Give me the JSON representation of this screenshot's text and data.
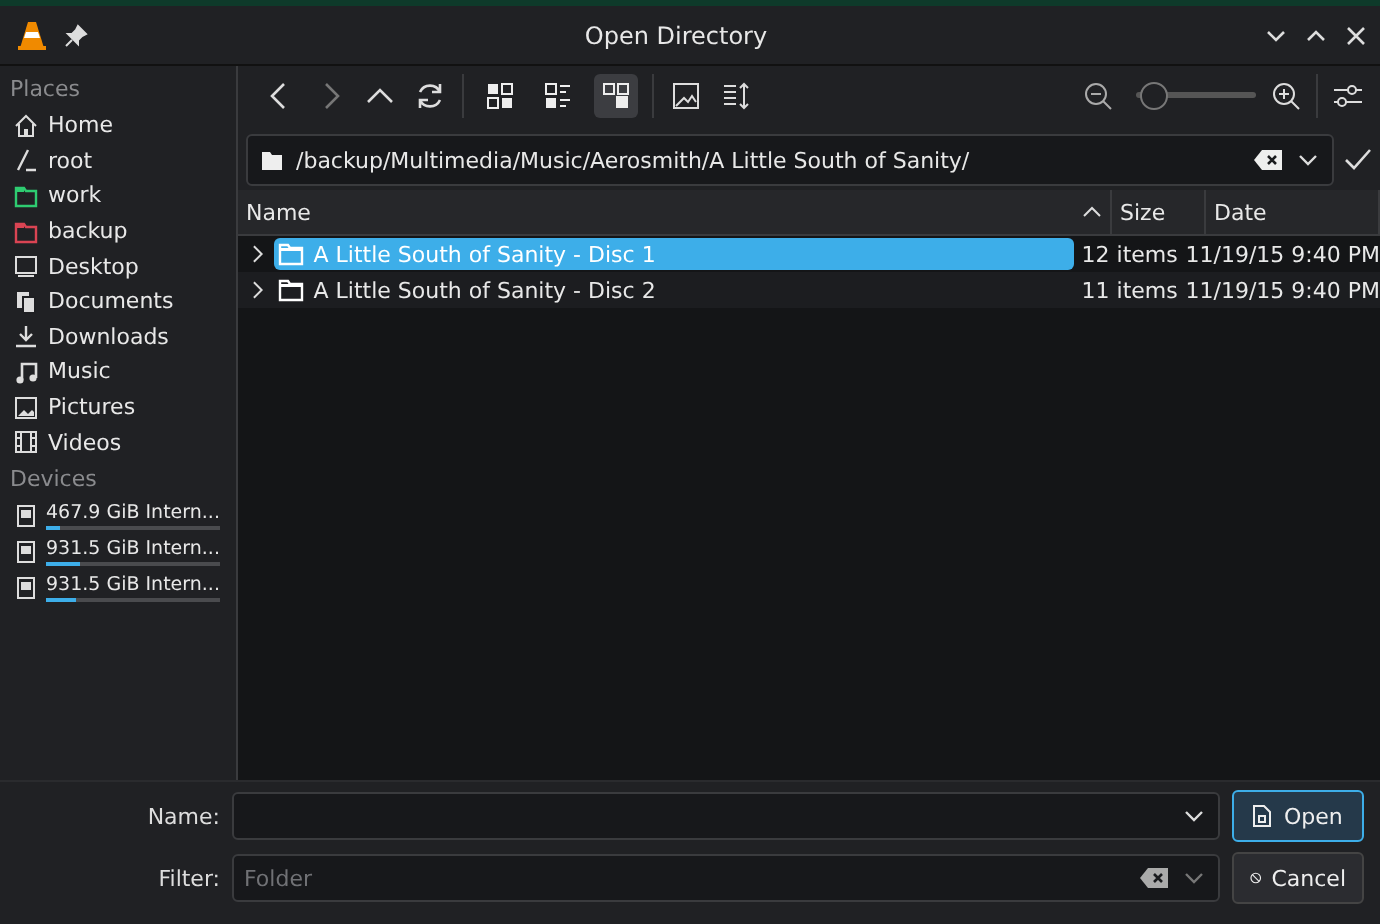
{
  "window": {
    "title": "Open Directory"
  },
  "toolbar": {
    "view_modes": [
      {
        "kind": "icons",
        "selected": false
      },
      {
        "kind": "compact",
        "selected": false
      },
      {
        "kind": "tree",
        "selected": true
      }
    ],
    "zoom": {
      "level": 0.1
    }
  },
  "location": {
    "path": "/backup/Multimedia/Music/Aerosmith/A Little South of Sanity/"
  },
  "sidebar": {
    "places_label": "Places",
    "places": [
      {
        "kind": "home",
        "label": "Home"
      },
      {
        "kind": "root",
        "label": "root"
      },
      {
        "kind": "folder",
        "label": "work",
        "color": "#2ecc71"
      },
      {
        "kind": "folder",
        "label": "backup",
        "color": "#da4453"
      },
      {
        "kind": "desktop",
        "label": "Desktop"
      },
      {
        "kind": "documents",
        "label": "Documents"
      },
      {
        "kind": "downloads",
        "label": "Downloads"
      },
      {
        "kind": "music",
        "label": "Music"
      },
      {
        "kind": "pictures",
        "label": "Pictures"
      },
      {
        "kind": "videos",
        "label": "Videos"
      }
    ],
    "devices_label": "Devices",
    "devices": [
      {
        "label": "467.9 GiB Intern...",
        "level": 0.08
      },
      {
        "label": "931.5 GiB Intern...",
        "level": 0.2
      },
      {
        "label": "931.5 GiB Intern...",
        "level": 0.17
      }
    ]
  },
  "table": {
    "columns": [
      {
        "label": "Name",
        "sorted": true
      },
      {
        "label": "Size",
        "sorted": false
      },
      {
        "label": "Date",
        "sorted": false
      }
    ],
    "rows": [
      {
        "name": "A Little South of Sanity - Disc 1",
        "size": "12 items",
        "date": "11/19/15 9:40 PM",
        "selected": true
      },
      {
        "name": "A Little South of Sanity - Disc 2",
        "size": "11 items",
        "date": "11/19/15 9:40 PM",
        "selected": false
      }
    ]
  },
  "name_field": {
    "label": "Name:"
  },
  "filter_field": {
    "label": "Filter:",
    "placeholder": "Folder"
  },
  "buttons": [
    {
      "kind": "open",
      "label": "Open"
    },
    {
      "kind": "cancel",
      "label": "Cancel"
    }
  ]
}
